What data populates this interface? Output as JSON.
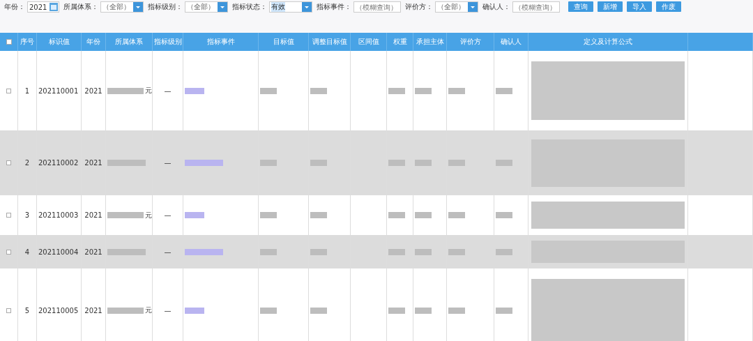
{
  "filters": [
    {
      "kind": "date",
      "label": "年份：",
      "value": "2021"
    },
    {
      "kind": "select",
      "label": "所属体系：",
      "value": "（全部）"
    },
    {
      "kind": "select",
      "label": "指标级别：",
      "value": "（全部）"
    },
    {
      "kind": "select",
      "label": "指标状态：",
      "value": "有效",
      "highlighted": true
    },
    {
      "kind": "text",
      "label": "指标事件：",
      "placeholder": "（模糊查询）"
    },
    {
      "kind": "select",
      "label": "评价方：",
      "value": "（全部）"
    },
    {
      "kind": "text",
      "label": "确认人：",
      "placeholder": "（模糊查询）"
    }
  ],
  "buttons": [
    "查询",
    "新增",
    "导入",
    "作废"
  ],
  "table": {
    "header_checked": false,
    "columns": [
      "序号",
      "标识值",
      "年份",
      "所属体系",
      "指标级别",
      "指标事件",
      "目标值",
      "调整目标值",
      "区间值",
      "权重",
      "承担主体",
      "评价方",
      "确认人",
      "定义及计算公式"
    ],
    "rows": [
      {
        "checked": false,
        "index": "1",
        "id": "202110001",
        "year": "2021",
        "system_tail": "元",
        "level": "—",
        "shaded": false
      },
      {
        "checked": false,
        "index": "2",
        "id": "202110002",
        "year": "2021",
        "level": "—",
        "shaded": true
      },
      {
        "checked": false,
        "index": "3",
        "id": "202110003",
        "year": "2021",
        "system_tail": "元",
        "level": "—",
        "shaded": false
      },
      {
        "checked": false,
        "index": "4",
        "id": "202110004",
        "year": "2021",
        "level": "—",
        "shaded": true
      },
      {
        "checked": false,
        "index": "5",
        "id": "202110005",
        "year": "2021",
        "system_tail": "元",
        "level": "—",
        "shaded": false
      }
    ]
  }
}
